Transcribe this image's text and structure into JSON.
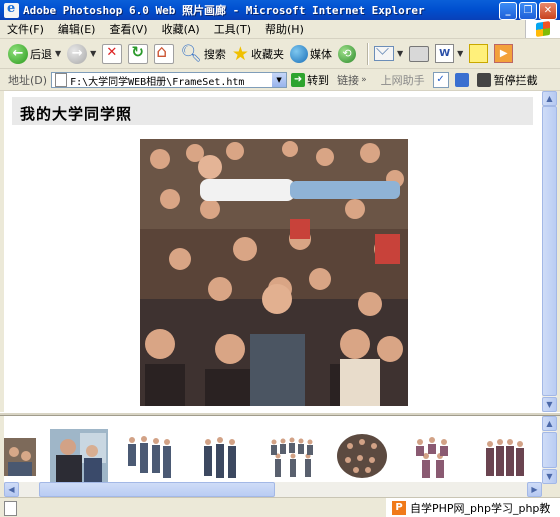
{
  "window": {
    "title": "Adobe Photoshop 6.0 Web 照片画廊 - Microsoft Internet Explorer"
  },
  "menu": [
    "文件(F)",
    "编辑(E)",
    "查看(V)",
    "收藏(A)",
    "工具(T)",
    "帮助(H)"
  ],
  "toolbar": {
    "back": "后退",
    "search": "搜索",
    "favorites": "收藏夹",
    "media": "媒体"
  },
  "address": {
    "label": "地址(D)",
    "value": "F:\\大学同学WEB相册\\FrameSet.htm",
    "go": "转到",
    "links": "链接",
    "helper": "上网助手",
    "block": "暂停拦截"
  },
  "page": {
    "heading": "我的大学同学照"
  },
  "statusbar": {
    "watermark": "自学PHP网_php学习_php教"
  },
  "colors": {
    "titlebar": "#0a5fd8",
    "chrome": "#ece9d8",
    "scrollbar": "#c1d3fb"
  },
  "icons": [
    "ie-icon",
    "back-arrow-icon",
    "forward-arrow-icon",
    "stop-icon",
    "refresh-icon",
    "home-icon",
    "search-icon",
    "favorites-star-icon",
    "media-globe-icon",
    "history-icon",
    "mail-icon",
    "print-icon",
    "edit-word-icon",
    "notes-icon",
    "messenger-icon"
  ]
}
